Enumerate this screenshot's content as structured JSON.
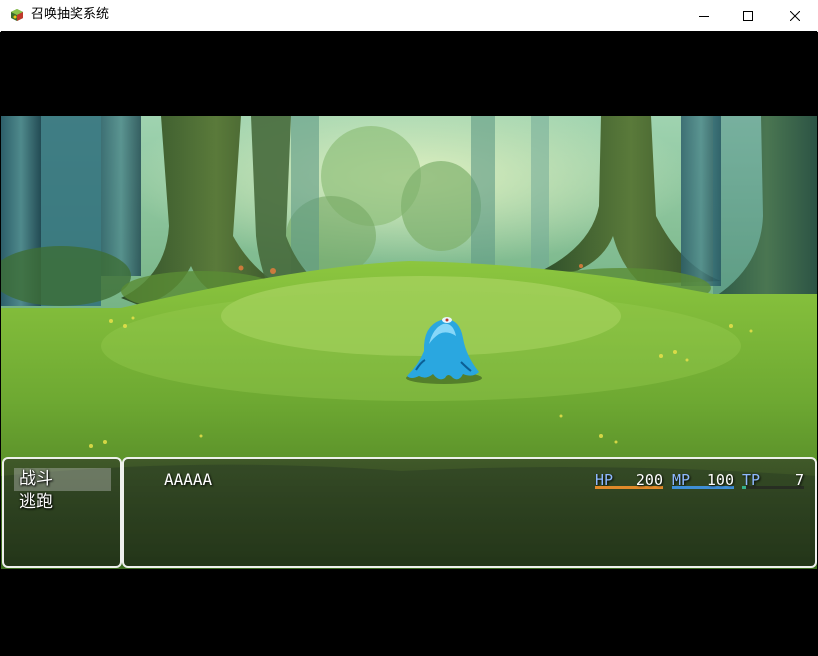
{
  "window": {
    "title": "召唤抽奖系统",
    "icon": "game-app-icon",
    "controls": [
      "minimize-icon",
      "maximize-icon",
      "close-icon"
    ]
  },
  "enemy": {
    "icon": "blue-slime-enemy"
  },
  "party_command": {
    "items": [
      {
        "label": "战斗",
        "selected": true
      },
      {
        "label": "逃跑",
        "selected": false
      }
    ]
  },
  "status": {
    "actor_name": "AAAAA",
    "hp": {
      "label": "HP",
      "value": "200",
      "fill": 1.0,
      "color": "#e08a2a"
    },
    "mp": {
      "label": "MP",
      "value": "100",
      "fill": 1.0,
      "color": "#3f8fd6"
    },
    "tp": {
      "label": "TP",
      "value": "7",
      "fill": 0.07,
      "color": "#35b08b"
    }
  },
  "colors": {
    "gauge_label": "#8eb8ff",
    "window_border": "#ffffff",
    "letterbox": "#000000"
  }
}
